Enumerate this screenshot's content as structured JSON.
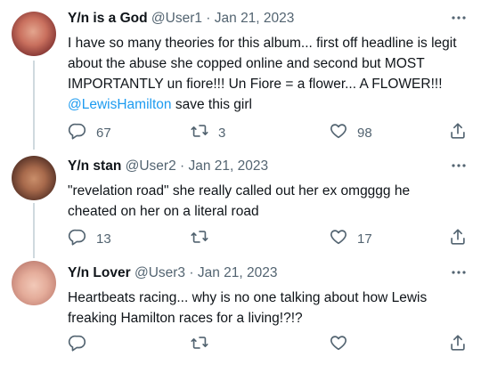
{
  "tweets": [
    {
      "display_name": "Y/n is a God",
      "handle": "@User1",
      "date": "Jan 21, 2023",
      "text_before": "I have so many theories for this album... first off headline is legit about the abuse she copped online and second but MOST IMPORTANTLY un fiore!!! Un Fiore = a flower... A FLOWER!!! ",
      "mention": "@LewisHamilton",
      "text_after": " save this girl",
      "replies": "67",
      "retweets": "3",
      "likes": "98"
    },
    {
      "display_name": "Y/n stan",
      "handle": "@User2",
      "date": "Jan 21, 2023",
      "text": "\"revelation road\" she really called out her ex omgggg he cheated on her on a literal road",
      "replies": "13",
      "retweets": "",
      "likes": "17"
    },
    {
      "display_name": "Y/n Lover",
      "handle": "@User3",
      "date": "Jan 21, 2023",
      "text": "Heartbeats racing... why is no one talking about how Lewis freaking Hamilton races for a living!?!?",
      "replies": "",
      "retweets": "",
      "likes": ""
    }
  ],
  "separator": " · ",
  "icons": {
    "reply": "reply-bubble-icon",
    "retweet": "retweet-arrows-icon",
    "like": "heart-icon",
    "share": "share-upload-icon",
    "more": "more-dots-icon"
  },
  "colors": {
    "text": "#0f1419",
    "secondary": "#536471",
    "link": "#1d9bf0",
    "thread_line": "#cfd9de"
  }
}
